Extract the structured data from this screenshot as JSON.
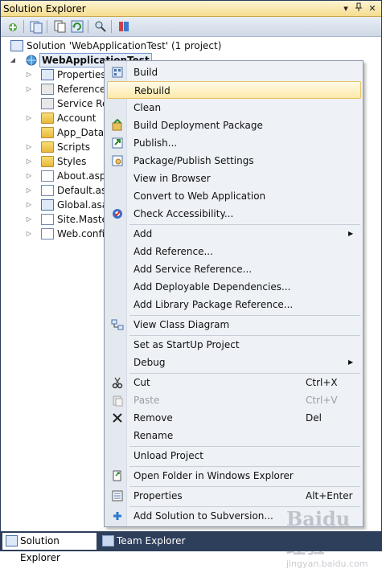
{
  "titlebar": {
    "title": "Solution Explorer",
    "pin_glyph": "▾ 📌 ✕"
  },
  "toolbar": {
    "buttons": [
      "add-icon",
      "show-all-files-icon",
      "refresh-icon",
      "copy-icon",
      "nest-icon",
      "find-icon",
      "properties-icon"
    ]
  },
  "tree": {
    "solution_label": "Solution 'WebApplicationTest' (1 project)",
    "project_label": "WebApplicationTest",
    "items": [
      {
        "label": "Properties",
        "icon": "properties-icon"
      },
      {
        "label": "References",
        "icon": "references-icon"
      },
      {
        "label": "Service Ref",
        "icon": "service-references-icon"
      },
      {
        "label": "Account",
        "icon": "folder-icon"
      },
      {
        "label": "App_Data",
        "icon": "folder-icon"
      },
      {
        "label": "Scripts",
        "icon": "folder-icon"
      },
      {
        "label": "Styles",
        "icon": "folder-icon"
      },
      {
        "label": "About.aspx",
        "icon": "aspx-file-icon"
      },
      {
        "label": "Default.asp",
        "icon": "aspx-file-icon"
      },
      {
        "label": "Global.asax",
        "icon": "asax-file-icon"
      },
      {
        "label": "Site.Master",
        "icon": "master-file-icon"
      },
      {
        "label": "Web.config",
        "icon": "config-file-icon"
      }
    ]
  },
  "menu": {
    "build": "Build",
    "rebuild": "Rebuild",
    "clean": "Clean",
    "build_deployment": "Build Deployment Package",
    "publish": "Publish...",
    "package_settings": "Package/Publish Settings",
    "view_browser": "View in Browser",
    "convert": "Convert to Web Application",
    "check_access": "Check Accessibility...",
    "add": "Add",
    "add_reference": "Add Reference...",
    "add_service_reference": "Add Service Reference...",
    "add_deployable": "Add Deployable Dependencies...",
    "add_library": "Add Library Package Reference...",
    "view_class": "View Class Diagram",
    "startup": "Set as StartUp Project",
    "debug": "Debug",
    "cut": "Cut",
    "cut_key": "Ctrl+X",
    "paste": "Paste",
    "paste_key": "Ctrl+V",
    "remove": "Remove",
    "remove_key": "Del",
    "rename": "Rename",
    "unload": "Unload Project",
    "open_folder": "Open Folder in Windows Explorer",
    "properties": "Properties",
    "properties_key": "Alt+Enter",
    "add_solution_svn": "Add Solution to Subversion..."
  },
  "tabs": {
    "solution_explorer": "Solution Explorer",
    "team_explorer": "Team Explorer"
  },
  "watermark": {
    "brand": "Baidu 经验",
    "url": "jingyan.baidu.com"
  }
}
